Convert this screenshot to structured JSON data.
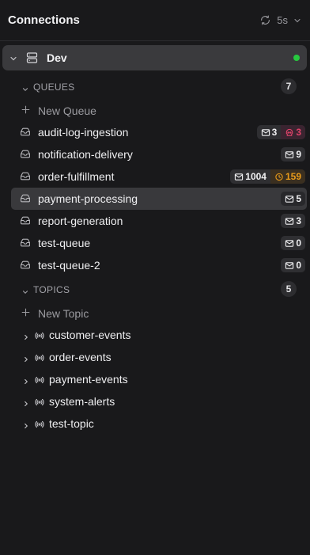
{
  "header": {
    "title": "Connections",
    "refresh_interval": "5s"
  },
  "connection": {
    "name": "Dev",
    "status_color": "#27c93f"
  },
  "queues": {
    "label": "QUEUES",
    "count": "7",
    "new_label": "New Queue",
    "items": [
      {
        "name": "audit-log-ingestion",
        "messages": "3",
        "dead_letter": "3"
      },
      {
        "name": "notification-delivery",
        "messages": "9"
      },
      {
        "name": "order-fulfillment",
        "messages": "1004",
        "delayed": "159"
      },
      {
        "name": "payment-processing",
        "messages": "5",
        "selected": true
      },
      {
        "name": "report-generation",
        "messages": "3"
      },
      {
        "name": "test-queue",
        "messages": "0"
      },
      {
        "name": "test-queue-2",
        "messages": "0"
      }
    ]
  },
  "topics": {
    "label": "TOPICS",
    "count": "5",
    "new_label": "New Topic",
    "items": [
      {
        "name": "customer-events"
      },
      {
        "name": "order-events"
      },
      {
        "name": "payment-events"
      },
      {
        "name": "system-alerts"
      },
      {
        "name": "test-topic"
      }
    ]
  },
  "colors": {
    "background": "#19191b",
    "selected_row": "#39393c",
    "dead_letter": "#e0436a",
    "delayed": "#e89a1a"
  }
}
